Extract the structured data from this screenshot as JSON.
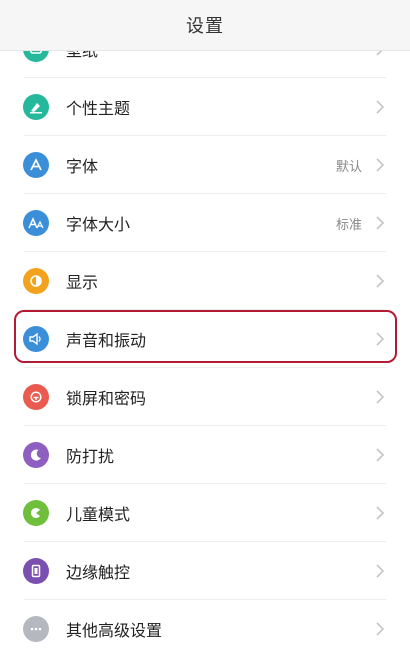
{
  "header": {
    "title": "设置"
  },
  "items": [
    {
      "label": "壁纸",
      "value": "",
      "icon": "wallpaper-icon",
      "color": "#26b89a"
    },
    {
      "label": "个性主题",
      "value": "",
      "icon": "theme-brush-icon",
      "color": "#26b89a"
    },
    {
      "label": "字体",
      "value": "默认",
      "icon": "font-icon",
      "color": "#3a8fd8"
    },
    {
      "label": "字体大小",
      "value": "标准",
      "icon": "font-size-icon",
      "color": "#3a8fd8"
    },
    {
      "label": "显示",
      "value": "",
      "icon": "display-brightness-icon",
      "color": "#f2a21c"
    },
    {
      "label": "声音和振动",
      "value": "",
      "icon": "speaker-icon",
      "color": "#3a8fd8"
    },
    {
      "label": "锁屏和密码",
      "value": "",
      "icon": "lock-icon",
      "color": "#ea5a4e"
    },
    {
      "label": "防打扰",
      "value": "",
      "icon": "moon-icon",
      "color": "#8e5fc1"
    },
    {
      "label": "儿童模式",
      "value": "",
      "icon": "child-mode-icon",
      "color": "#6fbe3c"
    },
    {
      "label": "边缘触控",
      "value": "",
      "icon": "edge-touch-icon",
      "color": "#7a4fb0"
    },
    {
      "label": "其他高级设置",
      "value": "",
      "icon": "more-icon",
      "color": "#b5b9bf"
    }
  ],
  "colors": {
    "highlight": "#b41a34"
  }
}
